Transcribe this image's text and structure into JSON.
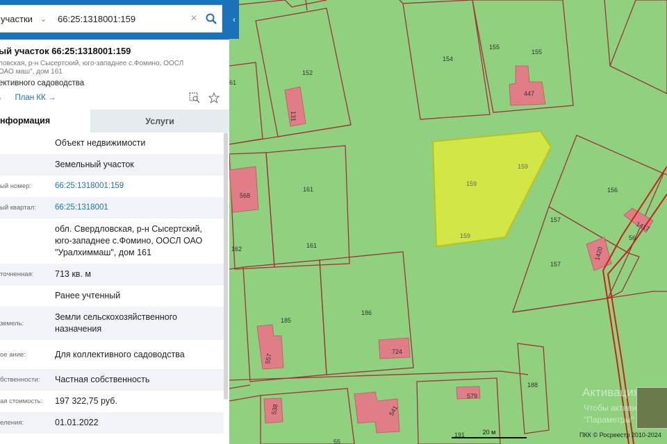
{
  "search": {
    "type_label": "участки",
    "query": "66:25:1318001:159"
  },
  "object": {
    "title": "ый участок 66:25:1318001:159",
    "address": "ловская, р-н Сысертский, юго-западнее с.Фомино, ООСЛ ОАО маш\", дом 161",
    "purpose": "ективного садоводства",
    "link1": "→",
    "link2": "План КК →"
  },
  "tabs": {
    "info": "нформация",
    "services": "Услуги"
  },
  "rows": [
    {
      "label": "",
      "value": "Объект недвижимости"
    },
    {
      "label": "",
      "value": "Земельный участок"
    },
    {
      "label": "ый номер:",
      "value": "66:25:1318001:159"
    },
    {
      "label": "ый квартал:",
      "value": "66:25:1318001"
    },
    {
      "label": "",
      "value": "обл. Свердловская, р-н Сысертский, юго-западнее с.Фомино, ООСЛ ОАО \"Уралхиммаш\", дом 161"
    },
    {
      "label": "точненная:",
      "value": "713 кв. м"
    },
    {
      "label": "",
      "value": "Ранее учтенный"
    },
    {
      "label": "земель:",
      "value": "Земли сельскохозяйственного назначения"
    },
    {
      "label": "ое ание:",
      "value": "Для коллективного садоводства"
    },
    {
      "label": "бственности:",
      "value": "Частная собственность"
    },
    {
      "label": "ая стоимость:",
      "value": "197 322,75 руб."
    },
    {
      "label": "еления:",
      "value": "01.01.2022"
    }
  ],
  "map": {
    "parcel_labels": [
      "152",
      "154",
      "155",
      "155",
      "161",
      "161",
      "162",
      "156",
      "157",
      "157",
      "185",
      "186",
      "188",
      "191",
      "159",
      "159",
      "159"
    ],
    "building_labels": [
      "131",
      "447",
      "568",
      "1420",
      "1417",
      "56",
      "557",
      "724",
      "538",
      "541",
      "579"
    ],
    "edge_label": "61",
    "bottom_label": "55",
    "scale_label": "20 м",
    "copyright": "ПКК © Росреестр 2010-2024",
    "watermark_title": "Активация Win",
    "watermark_line1": "Чтобы активировать",
    "watermark_line2": "\"Параметры\"",
    "colors": {
      "land": "#8fd17e",
      "border": "#a0303a",
      "building": "#e07d86",
      "selected": "#d2e646",
      "selected_border": "#b8c41a",
      "road": "#cc1f1f"
    }
  }
}
